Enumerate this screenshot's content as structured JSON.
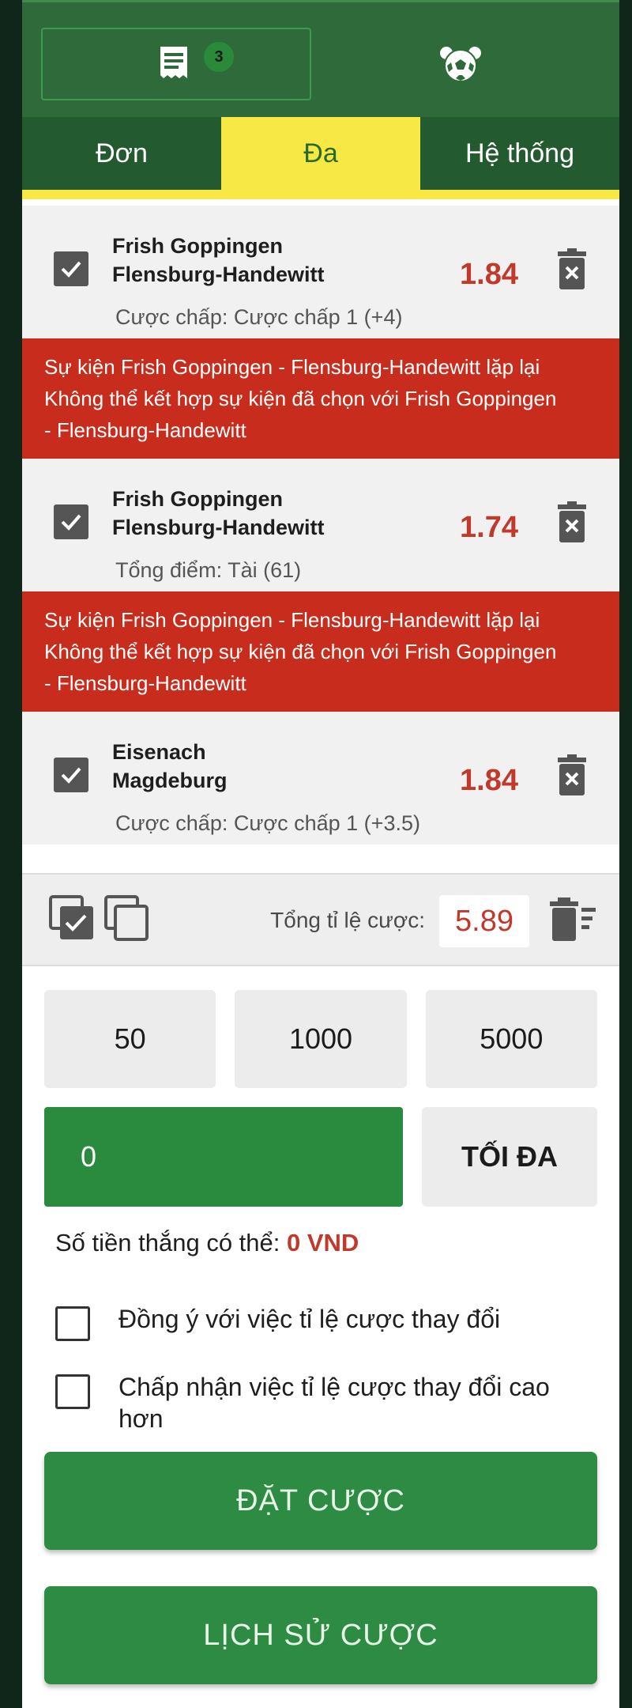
{
  "header": {
    "betslip_count": "3",
    "betslip_icon": "receipt-icon",
    "soccer_icon": "soccer-ball-icon"
  },
  "mode_tabs": [
    {
      "label": "Đơn",
      "active": false
    },
    {
      "label": "Đa",
      "active": true
    },
    {
      "label": "Hệ thống",
      "active": false
    }
  ],
  "bets": [
    {
      "team1": "Frish Goppingen",
      "team2": "Flensburg-Handewitt",
      "odds": "1.84",
      "market": "Cược chấp: Cược chấp 1 (+4)",
      "checked": true,
      "error_line1": "Sự kiện Frish Goppingen - Flensburg-Handewitt lặp lại",
      "error_line2": "Không thể kết hợp sự kiện đã chọn với Frish Goppingen",
      "error_line3": "- Flensburg-Handewitt"
    },
    {
      "team1": "Frish Goppingen",
      "team2": "Flensburg-Handewitt",
      "odds": "1.74",
      "market": "Tổng điểm: Tài (61)",
      "checked": true,
      "error_line1": "Sự kiện Frish Goppingen - Flensburg-Handewitt lặp lại",
      "error_line2": "Không thể kết hợp sự kiện đã chọn với Frish Goppingen",
      "error_line3": "- Flensburg-Handewitt"
    },
    {
      "team1": "Eisenach",
      "team2": "Magdeburg",
      "odds": "1.84",
      "market": "Cược chấp: Cược chấp 1 (+3.5)",
      "checked": true
    }
  ],
  "summary": {
    "total_label": "Tổng tỉ lệ cược:",
    "total_value": "5.89"
  },
  "quick_stakes": [
    "50",
    "1000",
    "5000"
  ],
  "stake": {
    "value": "0",
    "max_label": "TỐI ĐA"
  },
  "winnings": {
    "label": "Số tiền thắng có thể: ",
    "value": "0 VND"
  },
  "options": {
    "accept_change": "Đồng ý với việc tỉ lệ cược thay đổi",
    "accept_higher": "Chấp nhận việc tỉ lệ cược thay đổi cao hơn"
  },
  "buttons": {
    "place_bet": "ĐẶT CƯỢC",
    "history": "LỊCH SỬ CƯỢC"
  },
  "colors": {
    "header_green": "#2e6a3a",
    "tab_active_yellow": "#f8e845",
    "error_red": "#c72c1c",
    "odds_red": "#c0392b",
    "button_green": "#2e8b43"
  }
}
